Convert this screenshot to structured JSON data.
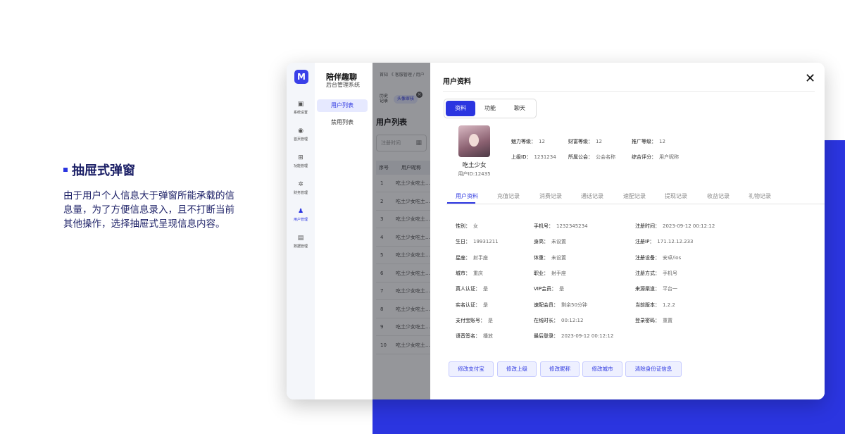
{
  "caption": {
    "title": "抽屉式弹窗",
    "body": "由于用户个人信息大于弹窗所能承载的信息量，为了方便信息录入，且不打断当前其他操作，选择抽屉式呈现信息内容。"
  },
  "app": {
    "logo_glyph": "M",
    "name": "陪伴趣聊",
    "subtitle": "后台管理系统",
    "accent": "#2b35e0"
  },
  "sidebar": {
    "items": [
      {
        "icon": "home-icon",
        "glyph": "▣",
        "label": "系统设置"
      },
      {
        "icon": "gift-icon",
        "glyph": "◉",
        "label": "首页管理"
      },
      {
        "icon": "grid-icon",
        "glyph": "⊞",
        "label": "功能管理"
      },
      {
        "icon": "gear-icon",
        "glyph": "✲",
        "label": "财务管理"
      },
      {
        "icon": "user-icon",
        "glyph": "♟",
        "label": "用户管理"
      },
      {
        "icon": "chart-icon",
        "glyph": "▤",
        "label": "数据管理"
      }
    ],
    "active_index": 4
  },
  "submenu": {
    "items": [
      "用户列表",
      "禁用列表"
    ],
    "active_index": 0
  },
  "breadcrumb": "首知  《    客服管理 / 用户",
  "history": {
    "label": "历史记录",
    "tags": [
      "头像审核"
    ],
    "close_glyph": "×"
  },
  "list": {
    "title": "用户列表",
    "date_placeholder": "注册时间",
    "calendar_glyph": "▦",
    "columns": [
      "序号",
      "用户昵称"
    ],
    "rows": [
      {
        "no": "1",
        "name": "吃土少女吃土..."
      },
      {
        "no": "2",
        "name": "吃土少女吃土..."
      },
      {
        "no": "3",
        "name": "吃土少女吃土..."
      },
      {
        "no": "4",
        "name": "吃土少女吃土..."
      },
      {
        "no": "5",
        "name": "吃土少女吃土..."
      },
      {
        "no": "6",
        "name": "吃土少女吃土..."
      },
      {
        "no": "7",
        "name": "吃土少女吃土..."
      },
      {
        "no": "8",
        "name": "吃土少女吃土..."
      },
      {
        "no": "9",
        "name": "吃土少女吃土..."
      },
      {
        "no": "10",
        "name": "吃土少女吃土..."
      }
    ]
  },
  "drawer": {
    "title": "用户资料",
    "close_glyph": "✕",
    "segments": [
      "资料",
      "功能",
      "聊天"
    ],
    "active_segment": 0,
    "profile": {
      "nickname": "吃土少女",
      "uid": "用户ID:12435",
      "summary": [
        {
          "label": "魅力等级：",
          "value": "12"
        },
        {
          "label": "财富等级：",
          "value": "12"
        },
        {
          "label": "推广等级：",
          "value": "12"
        },
        {
          "label": "上级ID：",
          "value": "1231234"
        },
        {
          "label": "所属公会：",
          "value": "公会名称"
        },
        {
          "label": "综合评分：",
          "value": "用户昵称"
        }
      ]
    },
    "tabs": [
      "用户资料",
      "充值记录",
      "消费记录",
      "通话记录",
      "速配记录",
      "提现记录",
      "收益记录",
      "礼物记录"
    ],
    "active_tab": 0,
    "details": {
      "col1": [
        {
          "label": "性别：",
          "value": "女"
        },
        {
          "label": "生日：",
          "value": "19931211"
        },
        {
          "label": "星座：",
          "value": "射手座"
        },
        {
          "label": "城市：",
          "value": "重庆"
        },
        {
          "label": "真人认证：",
          "value": "是"
        },
        {
          "label": "实名认证：",
          "value": "是"
        },
        {
          "label": "支付宝账号：",
          "value": "是"
        },
        {
          "label": "语音签名：",
          "value": "播放"
        }
      ],
      "col2": [
        {
          "label": "手机号：",
          "value": "1232345234"
        },
        {
          "label": "身高：",
          "value": "未设置"
        },
        {
          "label": "体重：",
          "value": "未设置"
        },
        {
          "label": "职业：",
          "value": "射手座"
        },
        {
          "label": "VIP会员：",
          "value": "是"
        },
        {
          "label": "速配会员：",
          "value": "剩余50分钟"
        },
        {
          "label": "在线时长：",
          "value": "00:12:12"
        },
        {
          "label": "最后登录：",
          "value": "2023-09-12 00:12:12"
        }
      ],
      "col3": [
        {
          "label": "注册时间：",
          "value": "2023-09-12 00:12:12"
        },
        {
          "label": "注册IP：",
          "value": "171.12.12.233"
        },
        {
          "label": "注册设备：",
          "value": "安卓/ios"
        },
        {
          "label": "注册方式：",
          "value": "手机号"
        },
        {
          "label": "来源渠道：",
          "value": "平台一"
        },
        {
          "label": "当前版本：",
          "value": "1.2.2"
        },
        {
          "label": "登录密码：",
          "value": "重置"
        }
      ]
    },
    "actions": [
      "修改支付宝",
      "修改上级",
      "修改昵称",
      "修改城市",
      "清除身份证信息"
    ]
  }
}
